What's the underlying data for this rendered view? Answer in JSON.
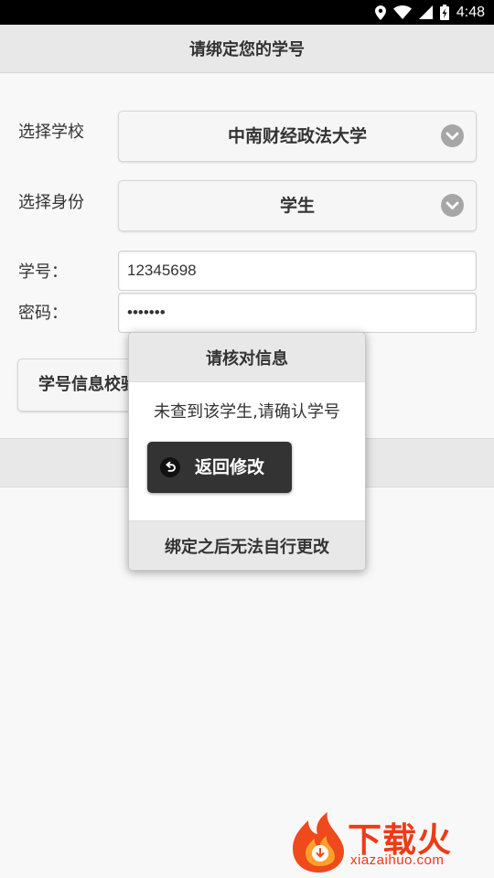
{
  "status_bar": {
    "time": "4:48",
    "icons": [
      "location-icon",
      "wifi-icon",
      "signal-icon",
      "battery-icon"
    ]
  },
  "header": {
    "title": "请绑定您的学号"
  },
  "form": {
    "school_label": "选择学校",
    "school_value": "中南财经政法大学",
    "identity_label": "选择身份",
    "identity_value": "学生",
    "student_id_label": "学号：",
    "student_id_value": "12345698",
    "password_label": "密码：",
    "password_value": "•••••••",
    "verify_button": "学号信息校验"
  },
  "popup": {
    "title": "请核对信息",
    "message": "未查到该学生,请确认学号",
    "back_button": "返回修改",
    "footer": "绑定之后无法自行更改"
  },
  "watermark": {
    "text": "下载火",
    "url": "xiazaihuo.com"
  },
  "colors": {
    "accent_dark": "#333333",
    "watermark": "#ec3b17"
  }
}
